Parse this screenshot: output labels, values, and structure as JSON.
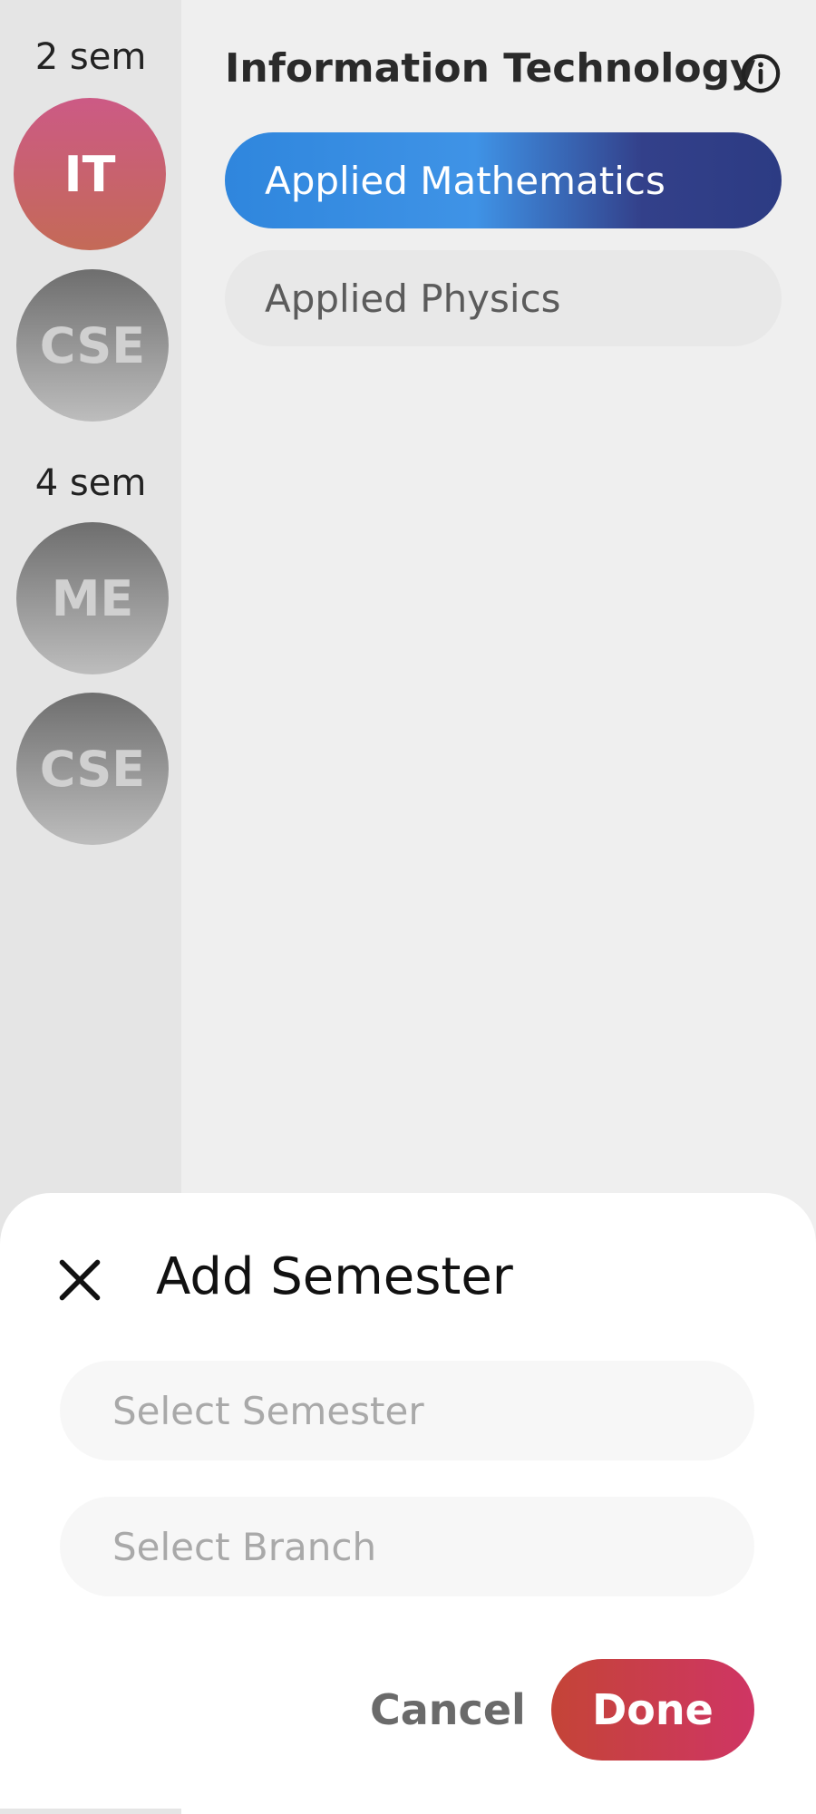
{
  "sidebar": {
    "groups": [
      {
        "label": "2 sem",
        "branches": [
          {
            "label": "IT",
            "selected": true
          },
          {
            "label": "CSE",
            "selected": false
          }
        ]
      },
      {
        "label": "4 sem",
        "branches": [
          {
            "label": "ME",
            "selected": false
          },
          {
            "label": "CSE",
            "selected": false
          }
        ]
      }
    ]
  },
  "main": {
    "title": "Information Technology",
    "info_icon": "info-circle-icon",
    "subjects": [
      {
        "label": "Applied Mathematics",
        "selected": true
      },
      {
        "label": "Applied Physics",
        "selected": false
      }
    ]
  },
  "sheet": {
    "title": "Add Semester",
    "close_icon": "close-icon",
    "semester_placeholder": "Select Semester",
    "branch_placeholder": "Select Branch",
    "cancel_label": "Cancel",
    "done_label": "Done"
  },
  "colors": {
    "active_branch": "#cc5a85",
    "active_subject_start": "#2f86dd",
    "active_subject_end": "#2c3b83",
    "done_start": "#c44437",
    "done_end": "#cf3564"
  }
}
